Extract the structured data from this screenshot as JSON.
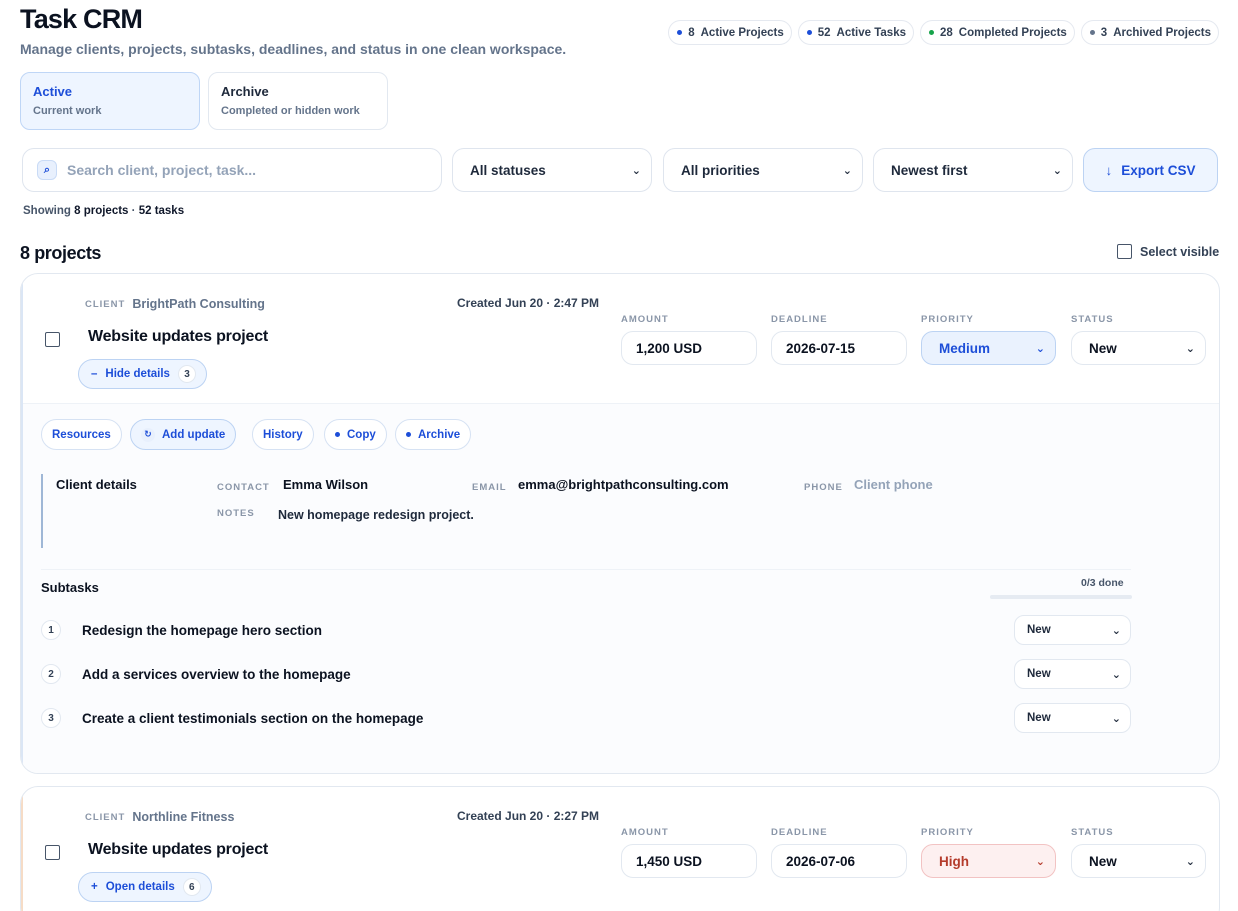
{
  "app": {
    "title": "Task CRM",
    "subtitle": "Manage clients, projects, subtasks, deadlines, and status in one clean workspace."
  },
  "stats": [
    {
      "value": "8",
      "label": "Active Projects",
      "color": "#1d4ed8"
    },
    {
      "value": "52",
      "label": "Active Tasks",
      "color": "#1d4ed8"
    },
    {
      "value": "28",
      "label": "Completed Projects",
      "color": "#16a34a"
    },
    {
      "value": "3",
      "label": "Archived Projects",
      "color": "#64748b"
    }
  ],
  "views": [
    {
      "title": "Active",
      "subtitle": "Current work",
      "selected": true
    },
    {
      "title": "Archive",
      "subtitle": "Completed or hidden work",
      "selected": false
    }
  ],
  "toolbar": {
    "search_placeholder": "Search client, project, task...",
    "search_icon": "search-icon",
    "status_filter": "All statuses",
    "priority_filter": "All priorities",
    "sort": "Newest first",
    "export_label": "Export CSV",
    "export_icon": "arrow-down-icon"
  },
  "summary": {
    "prefix": "Showing",
    "projects": "8 projects",
    "sep": "·",
    "tasks": "52 tasks"
  },
  "list": {
    "heading": "8 projects",
    "select_visible": "Select visible"
  },
  "labels": {
    "client": "CLIENT",
    "amount": "AMOUNT",
    "deadline": "DEADLINE",
    "priority": "PRIORITY",
    "status": "STATUS",
    "contact": "CONTACT",
    "email": "EMAIL",
    "phone": "PHONE",
    "notes": "NOTES"
  },
  "projects": [
    {
      "client": "BrightPath Consulting",
      "created": "Created Jun 20 · 2:47 PM",
      "title": "Website updates project",
      "toggle_label": "Hide details",
      "toggle_icon": "minus-icon",
      "task_count": "3",
      "amount": "1,200 USD",
      "deadline": "2026-07-15",
      "priority": "Medium",
      "status": "New",
      "actions": [
        "Resources",
        "Add update",
        "History",
        "Copy",
        "Archive"
      ],
      "client_details": {
        "heading": "Client details",
        "contact": "Emma Wilson",
        "email": "emma@brightpathconsulting.com",
        "phone_placeholder": "Client phone",
        "notes": "New homepage redesign project."
      },
      "subtasks": {
        "heading": "Subtasks",
        "progress_text": "0/3 done",
        "progress": 0,
        "items": [
          {
            "num": "1",
            "text": "Redesign the homepage hero section",
            "status": "New"
          },
          {
            "num": "2",
            "text": "Add a services overview to the homepage",
            "status": "New"
          },
          {
            "num": "3",
            "text": "Create a client testimonials section on the homepage",
            "status": "New"
          }
        ]
      }
    },
    {
      "client": "Northline Fitness",
      "created": "Created Jun 20 · 2:27 PM",
      "title": "Website updates project",
      "toggle_label": "Open details",
      "toggle_icon": "plus-icon",
      "task_count": "6",
      "amount": "1,450 USD",
      "deadline": "2026-07-06",
      "priority": "High",
      "status": "New"
    }
  ]
}
